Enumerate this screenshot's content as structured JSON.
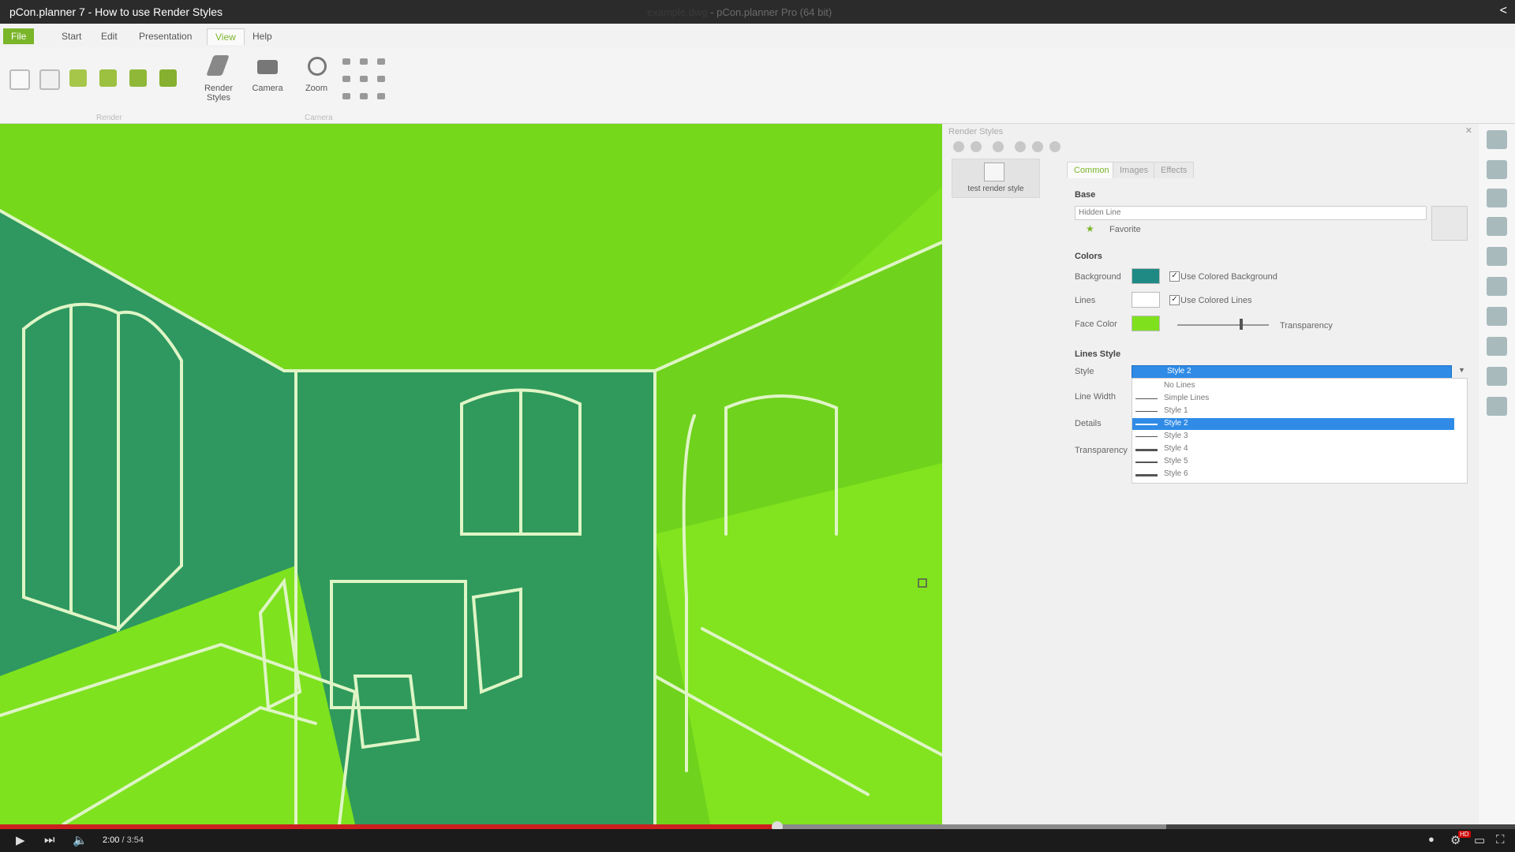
{
  "video": {
    "title": "pCon.planner 7 - How to use Render Styles",
    "current_time": "2:00",
    "duration": "3:54",
    "progress": 0.513,
    "buffered": 0.77,
    "hd_badge": "HD"
  },
  "app": {
    "file_name": "example.dwg",
    "product": "pCon.planner Pro (64 bit)"
  },
  "ribbon": {
    "tabs": [
      "File",
      "Start",
      "Edit",
      "Presentation",
      "View",
      "Help"
    ],
    "active_tab": "View",
    "render_styles_label": "Render Styles",
    "camera_label": "Camera",
    "zoom_label": "Zoom",
    "group_render": "Render",
    "group_camera": "Camera"
  },
  "panel": {
    "title": "Render Styles",
    "style_item": "test render style",
    "tabs": [
      "Common",
      "Images",
      "Effects"
    ],
    "active_tab": "Common",
    "base_section": "Base",
    "base_value": "Hidden Line",
    "favorite_label": "Favorite",
    "colors_section": "Colors",
    "background_label": "Background",
    "use_colored_background": "Use Colored Background",
    "lines_label": "Lines",
    "use_colored_lines": "Use Colored Lines",
    "face_color_label": "Face Color",
    "transparency_slider_label": "Transparency",
    "transparency_level": 0.68,
    "lines_style_section": "Lines Style",
    "style_label": "Style",
    "line_width_label": "Line Width",
    "details_label": "Details",
    "transparency_label": "Transparency",
    "style_selected": "Style 2",
    "style_options": [
      "No Lines",
      "Simple Lines",
      "Style 1",
      "Style 2",
      "Style 3",
      "Style 4",
      "Style 5",
      "Style 6"
    ],
    "colors": {
      "background": "#1f8a84",
      "lines": "#ffffff",
      "face": "#7fe01e"
    }
  }
}
